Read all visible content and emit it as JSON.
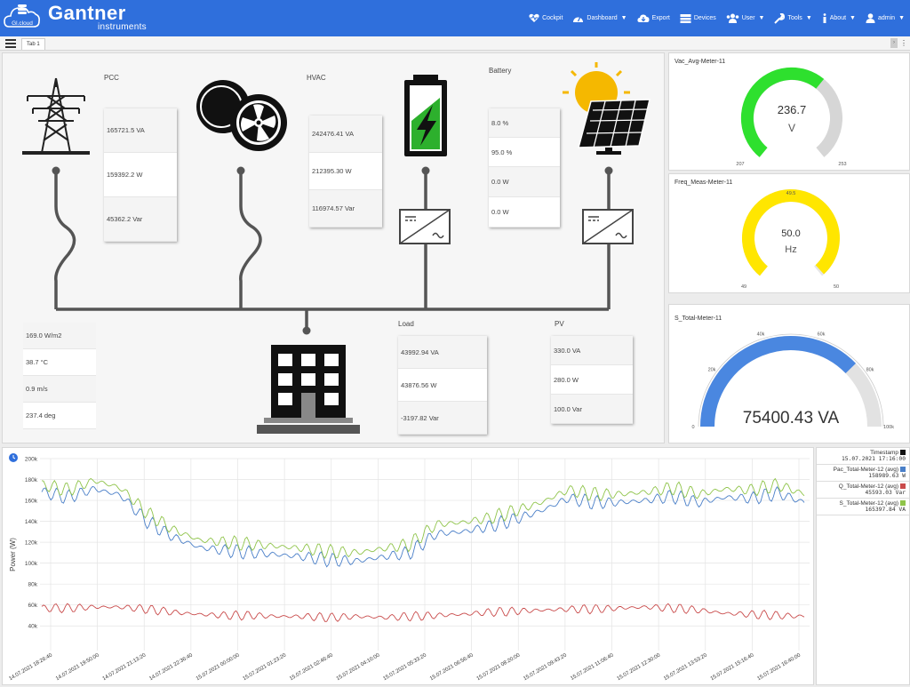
{
  "brand": {
    "cloud_label": "Gl.cloud",
    "name": "Gantner",
    "sub": "instruments"
  },
  "nav": [
    {
      "label": "Cockpit",
      "icon": "heart-pulse-icon",
      "caret": false
    },
    {
      "label": "Dashboard",
      "icon": "gauge-icon",
      "caret": true
    },
    {
      "label": "Export",
      "icon": "cloud-download-icon",
      "caret": false
    },
    {
      "label": "Devices",
      "icon": "devices-icon",
      "caret": false
    },
    {
      "label": "User",
      "icon": "users-icon",
      "caret": true
    },
    {
      "label": "Tools",
      "icon": "wrench-icon",
      "caret": true
    },
    {
      "label": "About",
      "icon": "info-icon",
      "caret": true
    },
    {
      "label": "admin",
      "icon": "user-icon",
      "caret": true
    }
  ],
  "tabs": {
    "active": "Tab 1"
  },
  "diagram": {
    "pcc": {
      "label": "PCC",
      "values": [
        "165721.5 VA",
        "159392.2 W",
        "45362.2 Var"
      ]
    },
    "hvac": {
      "label": "HVAC",
      "values": [
        "242476.41 VA",
        "212395.30 W",
        "116974.57 Var"
      ]
    },
    "battery": {
      "label": "Battery",
      "values": [
        "8.0 %",
        "95.0 %",
        "0.0 W",
        "0.0 W"
      ]
    },
    "weather": {
      "values": [
        "169.0 W/m2",
        "38.7 °C",
        "0.9 m/s",
        "237.4 deg"
      ]
    },
    "load": {
      "label": "Load",
      "values": [
        "43992.94 VA",
        "43876.56 W",
        "-3197.82 Var"
      ]
    },
    "pv": {
      "label": "PV",
      "values": [
        "330.0 VA",
        "280.0 W",
        "100.0 Var"
      ]
    }
  },
  "gauges": {
    "vac": {
      "title": "Vac_Avg-Meter-11",
      "value": "236.7",
      "unit": "V",
      "min": "207",
      "max": "253",
      "fraction": 0.64,
      "color": "#2ee02e"
    },
    "freq": {
      "title": "Freq_Meas-Meter-11",
      "value": "50.0",
      "unit": "Hz",
      "min": "49",
      "max": "50",
      "mid": "49.5",
      "fraction": 0.99,
      "color": "#ffe600"
    },
    "s_total": {
      "title": "S_Total-Meter-11",
      "value": "75400.43 VA",
      "ticks": [
        "0",
        "20k",
        "40k",
        "60k",
        "80k",
        "100k"
      ],
      "fraction": 0.754,
      "color": "#4a87e0"
    }
  },
  "legend": {
    "timestamp_label": "Timestamp",
    "timestamp_value": "15.07.2021 17:16:00",
    "series": [
      {
        "name": "Pac_Total-Meter-12 (avg)",
        "value": "158989.63 W",
        "color": "#4a7fc8"
      },
      {
        "name": "Q_Total-Meter-12 (avg)",
        "value": "45593.03 Var",
        "color": "#c94b4b"
      },
      {
        "name": "S_Total-Meter-12 (avg)",
        "value": "165397.84 VA",
        "color": "#8fc44a"
      }
    ]
  },
  "chart_data": {
    "type": "line",
    "ylabel": "Power (W)",
    "ylim": [
      30000,
      200000
    ],
    "y_ticks": [
      "200k",
      "180k",
      "160k",
      "140k",
      "120k",
      "100k",
      "80k",
      "60k",
      "40k"
    ],
    "x_ticks": [
      "14.07.2021 18:26:40",
      "14.07.2021 19:50:00",
      "14.07.2021 21:13:20",
      "14.07.2021 22:36:40",
      "15.07.2021 00:00:00",
      "15.07.2021 01:23:20",
      "15.07.2021 02:46:40",
      "15.07.2021 04:10:00",
      "15.07.2021 05:33:20",
      "15.07.2021 06:56:40",
      "15.07.2021 08:20:00",
      "15.07.2021 09:43:20",
      "15.07.2021 11:06:40",
      "15.07.2021 12:30:00",
      "15.07.2021 13:53:20",
      "15.07.2021 15:16:40",
      "15.07.2021 16:40:00"
    ],
    "grid": true,
    "series": [
      {
        "name": "Pac_Total-Meter-12 (avg)",
        "color": "#4a7fc8",
        "values": [
          168000,
          163000,
          171000,
          165000,
          140000,
          125000,
          115000,
          112000,
          110000,
          108000,
          106000,
          103000,
          102000,
          106000,
          110000,
          128000,
          130000,
          135000,
          142000,
          150000,
          162000,
          158000,
          158000,
          160000,
          164000,
          158000,
          163000,
          162000,
          167000,
          158000
        ]
      },
      {
        "name": "Q_Total-Meter-12 (avg)",
        "color": "#c94b4b",
        "values": [
          57000,
          57000,
          58000,
          58000,
          56000,
          53000,
          51000,
          50000,
          50000,
          49000,
          49000,
          48000,
          49000,
          48000,
          49000,
          50000,
          51000,
          53000,
          54000,
          55000,
          56000,
          56000,
          57000,
          58000,
          57000,
          55000,
          52000,
          51000,
          50000,
          49000
        ]
      },
      {
        "name": "S_Total-Meter-12 (avg)",
        "color": "#8fc44a",
        "values": [
          175000,
          170000,
          179000,
          172000,
          148000,
          132000,
          122000,
          120000,
          118000,
          116000,
          114000,
          111000,
          110000,
          114000,
          118000,
          137000,
          139000,
          143000,
          150000,
          158000,
          170000,
          166000,
          166000,
          168000,
          172000,
          166000,
          171000,
          170000,
          175000,
          166000
        ]
      }
    ]
  }
}
